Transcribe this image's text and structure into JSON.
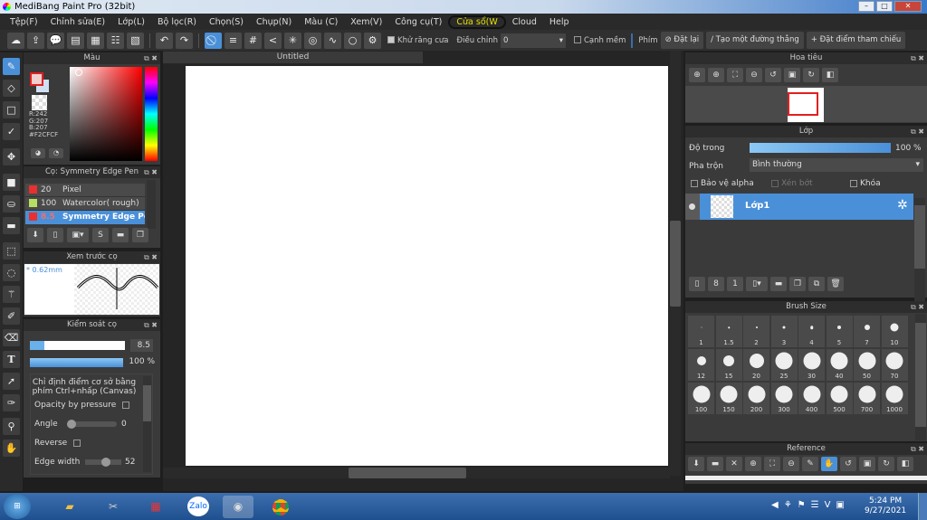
{
  "window": {
    "title": "MediBang Paint Pro (32bit)"
  },
  "menu": [
    "Tệp(F)",
    "Chỉnh sửa(E)",
    "Lớp(L)",
    "Bộ lọc(R)",
    "Chọn(S)",
    "Chụp(N)",
    "Màu (C)",
    "Xem(V)",
    "Công cụ(T)",
    "Cửa sổ(W",
    "Cloud",
    "Help"
  ],
  "toolbar": {
    "antialias": "Khử răng cưa",
    "adjust_label": "Điều chỉnh",
    "adjust_value": "0",
    "soft_edge": "Cạnh mềm",
    "key_label": "Phím",
    "reset": "Đặt lại",
    "straight_line": "Tạo một đường thẳng",
    "ref_point": "Đặt điểm tham chiếu"
  },
  "color_panel": {
    "title": "Màu",
    "r": "R:242",
    "g": "G:207",
    "b": "B:207",
    "hex": "#F2CFCF",
    "primary": "#f2cfcf",
    "secondary": "#cfe0f2"
  },
  "brush_panel": {
    "title": "Cọ: Symmetry Edge Pen",
    "items": [
      {
        "size": "20",
        "name": "Pixel",
        "color": "#e83030"
      },
      {
        "size": "100",
        "name": "Watercolor( rough)",
        "color": "#b8e060"
      },
      {
        "size": "8.5",
        "name": "Symmetry Edge Pen",
        "color": "#e83030",
        "selected": true
      }
    ]
  },
  "preview_panel": {
    "title": "Xem trước cọ",
    "size": "* 0.62mm"
  },
  "brush_control": {
    "title": "Kiểm soát cọ",
    "size_value": "8.5",
    "size_fraction": 0.085,
    "opacity_value": "100 %",
    "hint": "Chỉ định điểm cơ sở bằng phím Ctrl+nhấp (Canvas)",
    "opacity_pressure": "Opacity by pressure",
    "angle_label": "Angle",
    "angle_value": "0",
    "reverse": "Reverse",
    "edge_label": "Edge width",
    "edge_value": "52"
  },
  "canvas": {
    "tab": "Untitled"
  },
  "navigator": {
    "title": "Hoa tiêu"
  },
  "layer_panel": {
    "title": "Lớp",
    "opacity_label": "Độ trong",
    "opacity_value": "100 %",
    "blend_label": "Pha trộn",
    "blend_value": "Bình thường",
    "protect_alpha": "Bảo vệ alpha",
    "clip": "Xén bớt",
    "lock": "Khóa",
    "layers": [
      {
        "name": "Lớp1"
      }
    ]
  },
  "brush_size": {
    "title": "Brush Size",
    "sizes": [
      "1",
      "1.5",
      "2",
      "3",
      "4",
      "5",
      "7",
      "10",
      "12",
      "15",
      "20",
      "25",
      "30",
      "40",
      "50",
      "70",
      "100",
      "150",
      "200",
      "300",
      "400",
      "500",
      "700",
      "1000"
    ]
  },
  "reference": {
    "title": "Reference"
  },
  "taskbar": {
    "time": "5:24 PM",
    "date": "9/27/2021"
  }
}
